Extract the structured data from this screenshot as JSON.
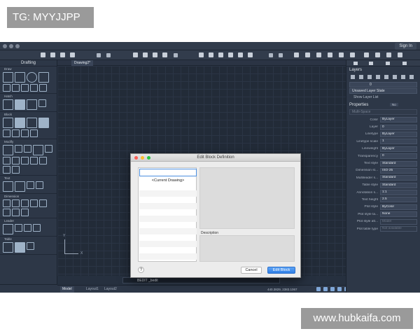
{
  "watermarks": {
    "tag": "TG: MYYJJPP",
    "site": "www.hubkaifa.com"
  },
  "window": {
    "signin": "Sign In"
  },
  "left_palette": {
    "title": "Drafting",
    "sections": [
      "Draw",
      "Hatch",
      "Block",
      "Modify",
      "Text",
      "Dimension",
      "Leader",
      "Table"
    ]
  },
  "document": {
    "tab_label": "Drawing2*"
  },
  "canvas": {
    "ucs_x": "X",
    "ucs_y": "Y"
  },
  "command_line": {
    "text": "BEDIT _bedit"
  },
  "status_bar": {
    "tabs": [
      "Model",
      "Layout1",
      "Layout2"
    ],
    "coordinates": "440.3829, 2383.1067"
  },
  "right_panel": {
    "layers_title": "Layers",
    "layer_current": "0",
    "layer_state": "Unsaved Layer State",
    "show_layer_list": "Show Layer List",
    "properties_title": "Properties",
    "properties_toggle": "No",
    "space_field": "Multi-Space",
    "properties": [
      {
        "name": "Color",
        "value": "ByLayer",
        "dim": false
      },
      {
        "name": "Layer",
        "value": "0",
        "dim": false
      },
      {
        "name": "Linetype",
        "value": "ByLayer",
        "dim": false
      },
      {
        "name": "Linetype scale",
        "value": "1",
        "dim": false
      },
      {
        "name": "Lineweight",
        "value": "ByLayer",
        "dim": false
      },
      {
        "name": "Transparency",
        "value": "0",
        "dim": false
      },
      {
        "name": "Text style",
        "value": "Standard",
        "dim": false
      },
      {
        "name": "Dimension st...",
        "value": "ISO-25",
        "dim": false
      },
      {
        "name": "Multileader s...",
        "value": "Standard",
        "dim": false
      },
      {
        "name": "Table style",
        "value": "Standard",
        "dim": false
      },
      {
        "name": "Annotation s...",
        "value": "1:1",
        "dim": false
      },
      {
        "name": "Text height",
        "value": "2.5",
        "dim": false
      },
      {
        "name": "Plot style",
        "value": "ByColor",
        "dim": false
      },
      {
        "name": "Plot style ta...",
        "value": "None",
        "dim": false
      },
      {
        "name": "Plot style att...",
        "value": "Model",
        "dim": true
      },
      {
        "name": "Plot table type",
        "value": "Not available",
        "dim": true
      }
    ]
  },
  "dialog": {
    "title": "Edit Block Definition",
    "search_value": "",
    "list_items": [
      "<Current Drawing>"
    ],
    "description_label": "Description",
    "help_label": "?",
    "cancel_label": "Cancel",
    "ok_label": "Edit Block"
  },
  "colors": {
    "app_background": "#26303f",
    "panel_background": "#2d3747",
    "accent_blue": "#2f7fe6",
    "traffic_close": "#fc5f57",
    "traffic_min": "#fdbc2e",
    "traffic_max": "#28c840"
  }
}
